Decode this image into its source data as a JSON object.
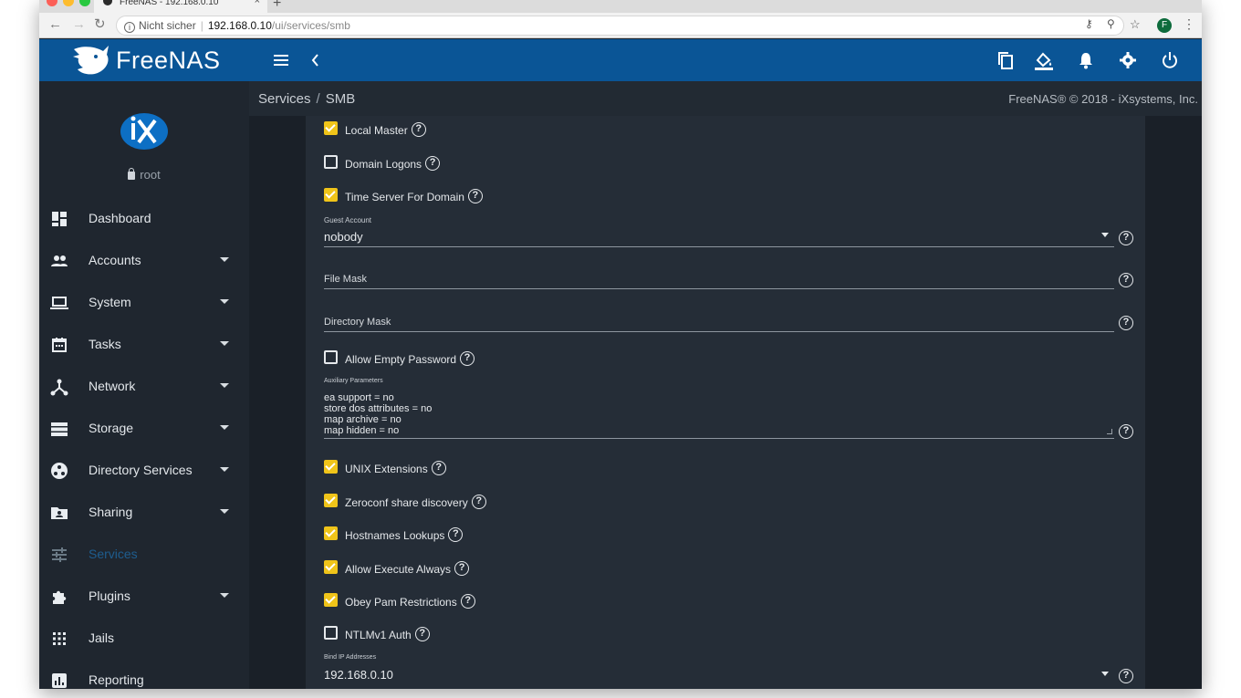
{
  "browser": {
    "tab_title": "FreeNAS - 192.168.0.10",
    "tab_close": "×",
    "new_tab": "+",
    "security_label": "Nicht sicher",
    "url_host": "192.168.0.10",
    "url_path": "/ui/services/smb",
    "profile_initial": "F"
  },
  "app": {
    "logo_text": "FreeNAS",
    "user": "root"
  },
  "breadcrumb": {
    "parent": "Services",
    "current": "SMB",
    "separator": "/"
  },
  "copyright": "FreeNAS® © 2018 - iXsystems, Inc.",
  "sidebar": {
    "items": [
      {
        "label": "Dashboard",
        "icon": "dashboard-icon",
        "has_caret": false
      },
      {
        "label": "Accounts",
        "icon": "people-icon",
        "has_caret": true
      },
      {
        "label": "System",
        "icon": "laptop-icon",
        "has_caret": true
      },
      {
        "label": "Tasks",
        "icon": "calendar-icon",
        "has_caret": true
      },
      {
        "label": "Network",
        "icon": "network-icon",
        "has_caret": true
      },
      {
        "label": "Storage",
        "icon": "storage-icon",
        "has_caret": true
      },
      {
        "label": "Directory Services",
        "icon": "directory-icon",
        "has_caret": true
      },
      {
        "label": "Sharing",
        "icon": "folder-shared-icon",
        "has_caret": true
      },
      {
        "label": "Services",
        "icon": "tune-icon",
        "has_caret": false,
        "active": true
      },
      {
        "label": "Plugins",
        "icon": "extension-icon",
        "has_caret": true
      },
      {
        "label": "Jails",
        "icon": "apps-icon",
        "has_caret": false
      },
      {
        "label": "Reporting",
        "icon": "chart-icon",
        "has_caret": false
      }
    ]
  },
  "form": {
    "local_master": {
      "label": "Local Master",
      "checked": true
    },
    "domain_logons": {
      "label": "Domain Logons",
      "checked": false
    },
    "time_server": {
      "label": "Time Server For Domain",
      "checked": true
    },
    "guest_account": {
      "label": "Guest Account",
      "value": "nobody"
    },
    "file_mask": {
      "placeholder": "File Mask"
    },
    "directory_mask": {
      "placeholder": "Directory Mask"
    },
    "allow_empty_password": {
      "label": "Allow Empty Password",
      "checked": false
    },
    "aux_params": {
      "label": "Auxiliary Parameters",
      "lines": [
        "ea support = no",
        "store dos attributes = no",
        "map archive = no",
        "map hidden = no"
      ]
    },
    "unix_extensions": {
      "label": "UNIX Extensions",
      "checked": true
    },
    "zeroconf": {
      "label": "Zeroconf share discovery",
      "checked": true
    },
    "hostnames_lookups": {
      "label": "Hostnames Lookups",
      "checked": true
    },
    "allow_execute_always": {
      "label": "Allow Execute Always",
      "checked": true
    },
    "obey_pam": {
      "label": "Obey Pam Restrictions",
      "checked": true
    },
    "ntlmv1": {
      "label": "NTLMv1 Auth",
      "checked": false
    },
    "bind_ip": {
      "label": "Bind IP Addresses",
      "value": "192.168.0.10"
    }
  },
  "colors": {
    "header": "#0a5596",
    "sidebar": "#1f262f",
    "checkbox_checked": "#f0c419",
    "active_nav": "#1e5d8f"
  }
}
